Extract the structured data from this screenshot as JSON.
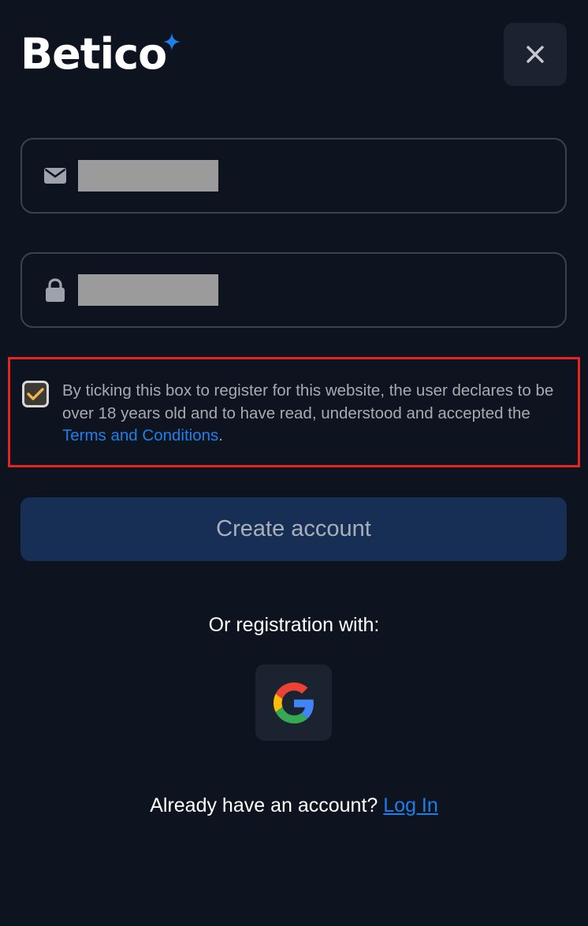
{
  "brand": {
    "name": "Betico",
    "accent_color": "#1f7fe8"
  },
  "header": {
    "close_icon": "close-icon"
  },
  "form": {
    "email": {
      "icon": "mail-icon",
      "value": ""
    },
    "password": {
      "icon": "lock-icon",
      "value": ""
    },
    "consent": {
      "checked": true,
      "text_before": "By ticking this box to register for this website, the user declares to be over 18 years old and to have read, understood and accepted the ",
      "link_label": "Terms and Conditions",
      "text_after": "."
    },
    "submit_label": "Create account"
  },
  "social": {
    "heading": "Or registration with:",
    "google_icon": "google-icon"
  },
  "footer": {
    "prompt": "Already have an account?",
    "login_label": "Log In"
  },
  "colors": {
    "background": "#0e141f",
    "field_border": "#3a4150",
    "button_bg": "#172f55",
    "highlight_border": "#e52521",
    "checkbox_check": "#f2b34d"
  }
}
